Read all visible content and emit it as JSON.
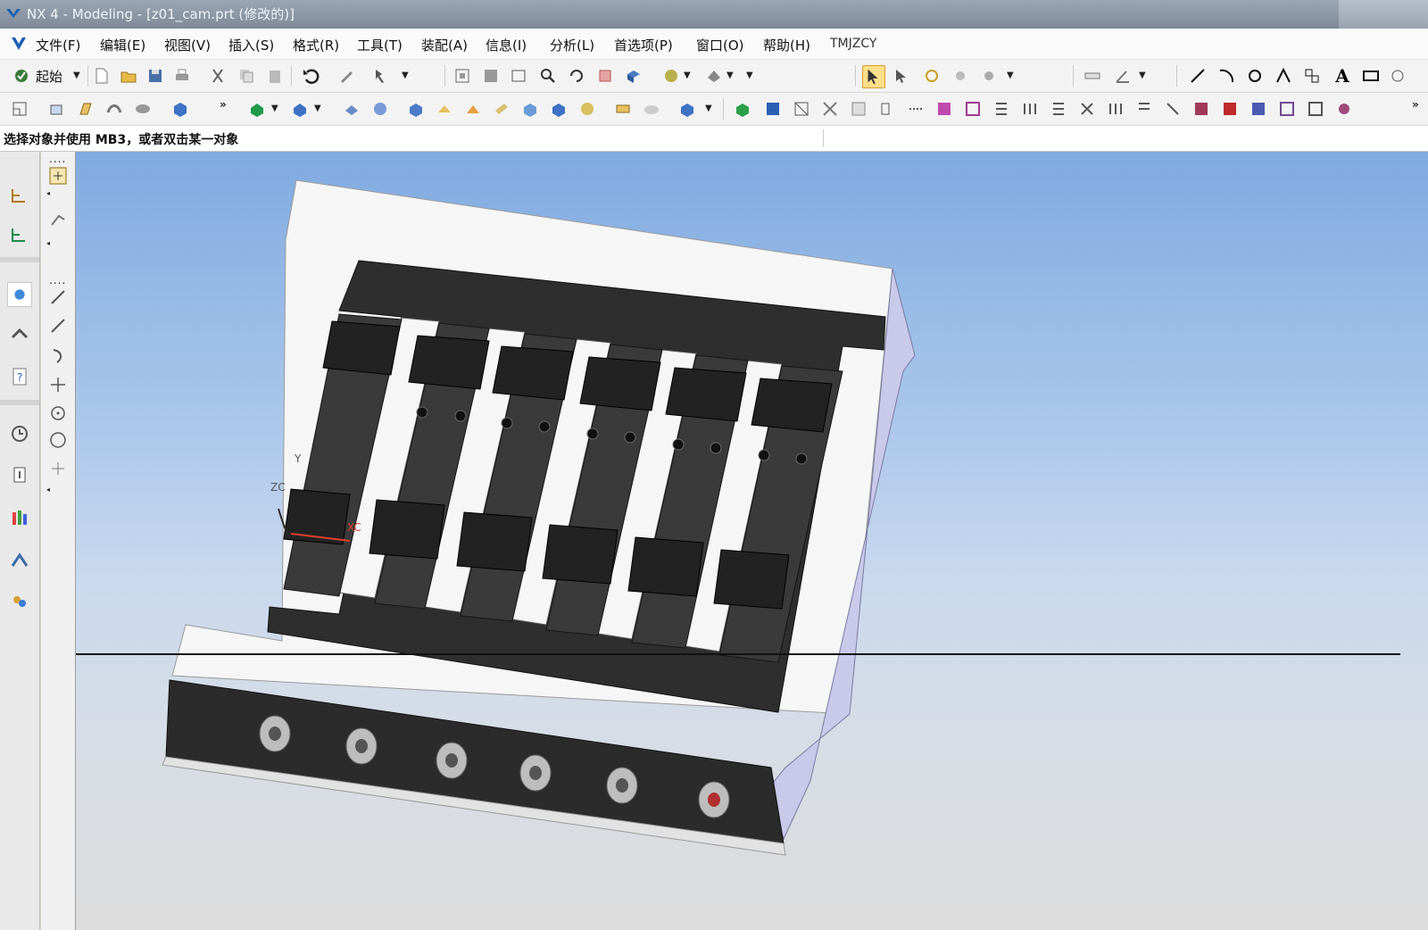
{
  "window": {
    "title": "NX 4 - Modeling - [z01_cam.prt (修改的)]"
  },
  "menubar": {
    "items": [
      {
        "label": "文件(F)"
      },
      {
        "label": "编辑(E)"
      },
      {
        "label": "视图(V)"
      },
      {
        "label": "插入(S)"
      },
      {
        "label": "格式(R)"
      },
      {
        "label": "工具(T)"
      },
      {
        "label": "装配(A)"
      },
      {
        "label": "信息(I)"
      },
      {
        "label": "分析(L)"
      },
      {
        "label": "首选项(P)"
      },
      {
        "label": "窗口(O)"
      },
      {
        "label": "帮助(H)"
      },
      {
        "label": "TMJZCY"
      }
    ]
  },
  "toolbar": {
    "start_label": "起始",
    "text_tool_glyph": "A"
  },
  "status": {
    "prompt": "选择对象并使用 MB3，或者双击某一对象"
  },
  "viewport": {
    "triad": {
      "x_label": "XC",
      "y_label": "Y",
      "z_label": "ZC"
    },
    "colors": {
      "background_top": "#7faae0",
      "background_bottom": "#dcdcdc",
      "part_dark": "#2b2b2b",
      "fixture_white": "#f6f6f6",
      "fixture_side": "#c9c9ea"
    }
  }
}
